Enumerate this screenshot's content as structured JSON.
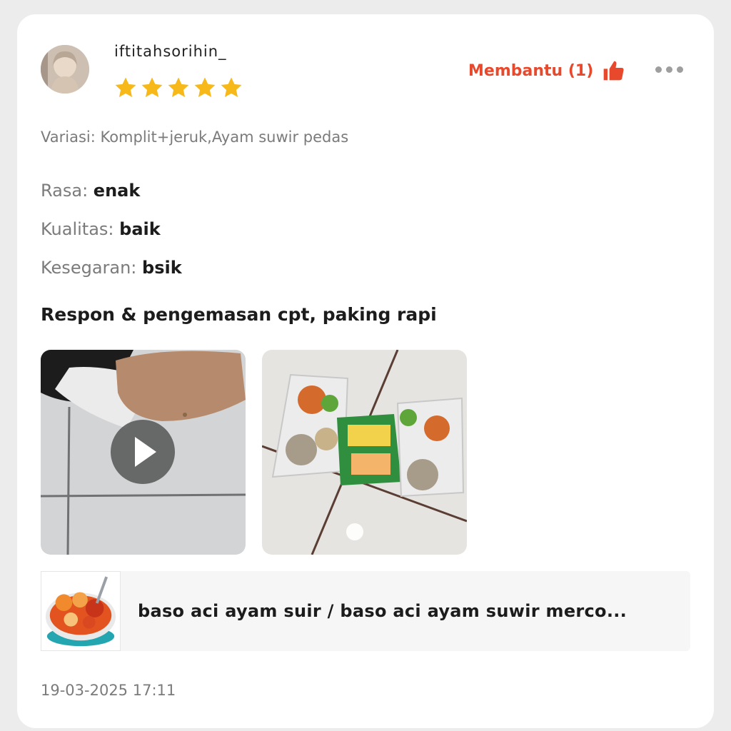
{
  "review": {
    "username": "iftitahsorihin_",
    "rating": 5,
    "helpful_label": "Membantu (1)",
    "variant": "Variasi: Komplit+jeruk,Ayam suwir pedas",
    "attributes": [
      {
        "label": "Rasa:",
        "value": "enak"
      },
      {
        "label": "Kualitas:",
        "value": "baik"
      },
      {
        "label": "Kesegaran:",
        "value": "bsik"
      }
    ],
    "comment": "Respon & pengemasan cpt, paking rapi",
    "timestamp": "19-03-2025 17:11"
  },
  "product": {
    "title": "baso aci ayam suir / baso aci ayam suwir merco..."
  },
  "media": [
    {
      "type": "video",
      "icon": "play-icon"
    },
    {
      "type": "photo"
    }
  ],
  "colors": {
    "accent": "#e8482c",
    "star": "#f7b91a",
    "muted_text": "#7b7b7b"
  }
}
